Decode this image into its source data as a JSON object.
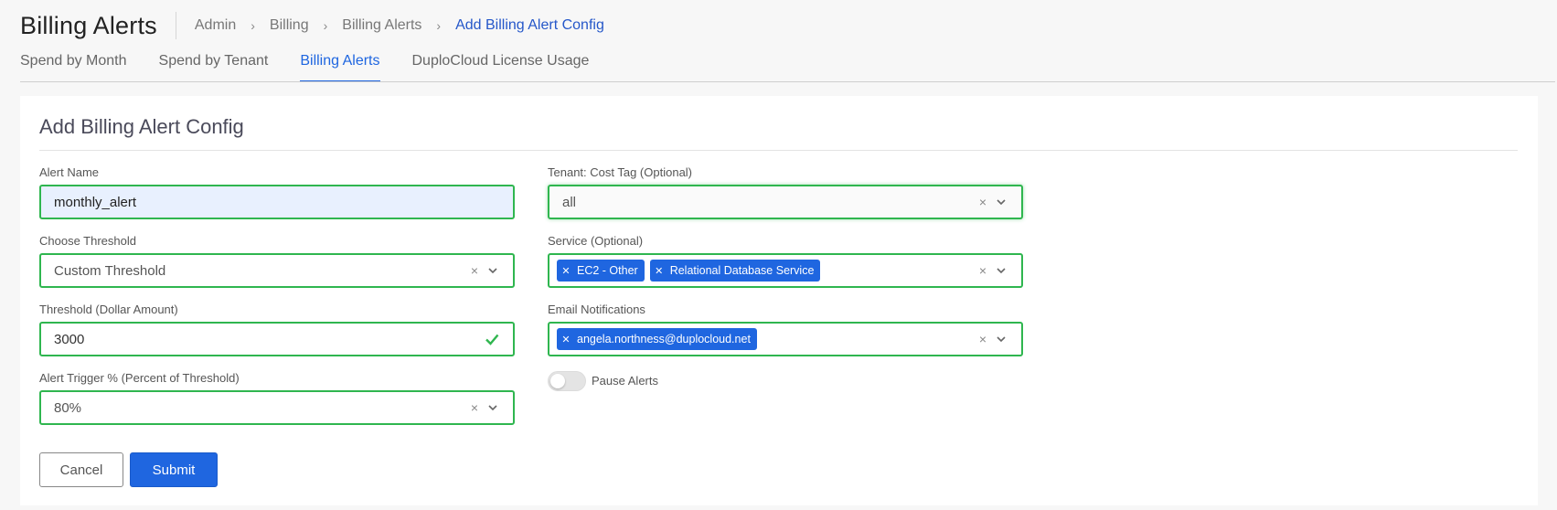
{
  "header": {
    "title": "Billing Alerts",
    "breadcrumb": [
      "Admin",
      "Billing",
      "Billing Alerts",
      "Add Billing Alert Config"
    ]
  },
  "tabs": [
    {
      "label": "Spend by Month",
      "active": false
    },
    {
      "label": "Spend by Tenant",
      "active": false
    },
    {
      "label": "Billing Alerts",
      "active": true
    },
    {
      "label": "DuploCloud License Usage",
      "active": false
    }
  ],
  "form": {
    "title": "Add Billing Alert Config",
    "alert_name": {
      "label": "Alert Name",
      "value": "monthly_alert"
    },
    "threshold_choice": {
      "label": "Choose Threshold",
      "value": "Custom Threshold"
    },
    "threshold_amount": {
      "label": "Threshold (Dollar Amount)",
      "value": "3000"
    },
    "trigger_percent": {
      "label": "Alert Trigger % (Percent of Threshold)",
      "value": "80%"
    },
    "tenant_tag": {
      "label": "Tenant: Cost Tag (Optional)",
      "value": "all"
    },
    "service": {
      "label": "Service (Optional)",
      "chips": [
        "EC2 - Other",
        "Relational Database Service"
      ]
    },
    "email": {
      "label": "Email Notifications",
      "chips": [
        "angela.northness@duplocloud.net"
      ]
    },
    "pause": {
      "label": "Pause Alerts",
      "enabled": false
    },
    "cancel_label": "Cancel",
    "submit_label": "Submit"
  },
  "colors": {
    "accent": "#1f66e0",
    "valid_border": "#2fb64f"
  },
  "icons": {
    "clear": "×",
    "chevron": "chevron-down-icon",
    "check": "check-icon"
  }
}
